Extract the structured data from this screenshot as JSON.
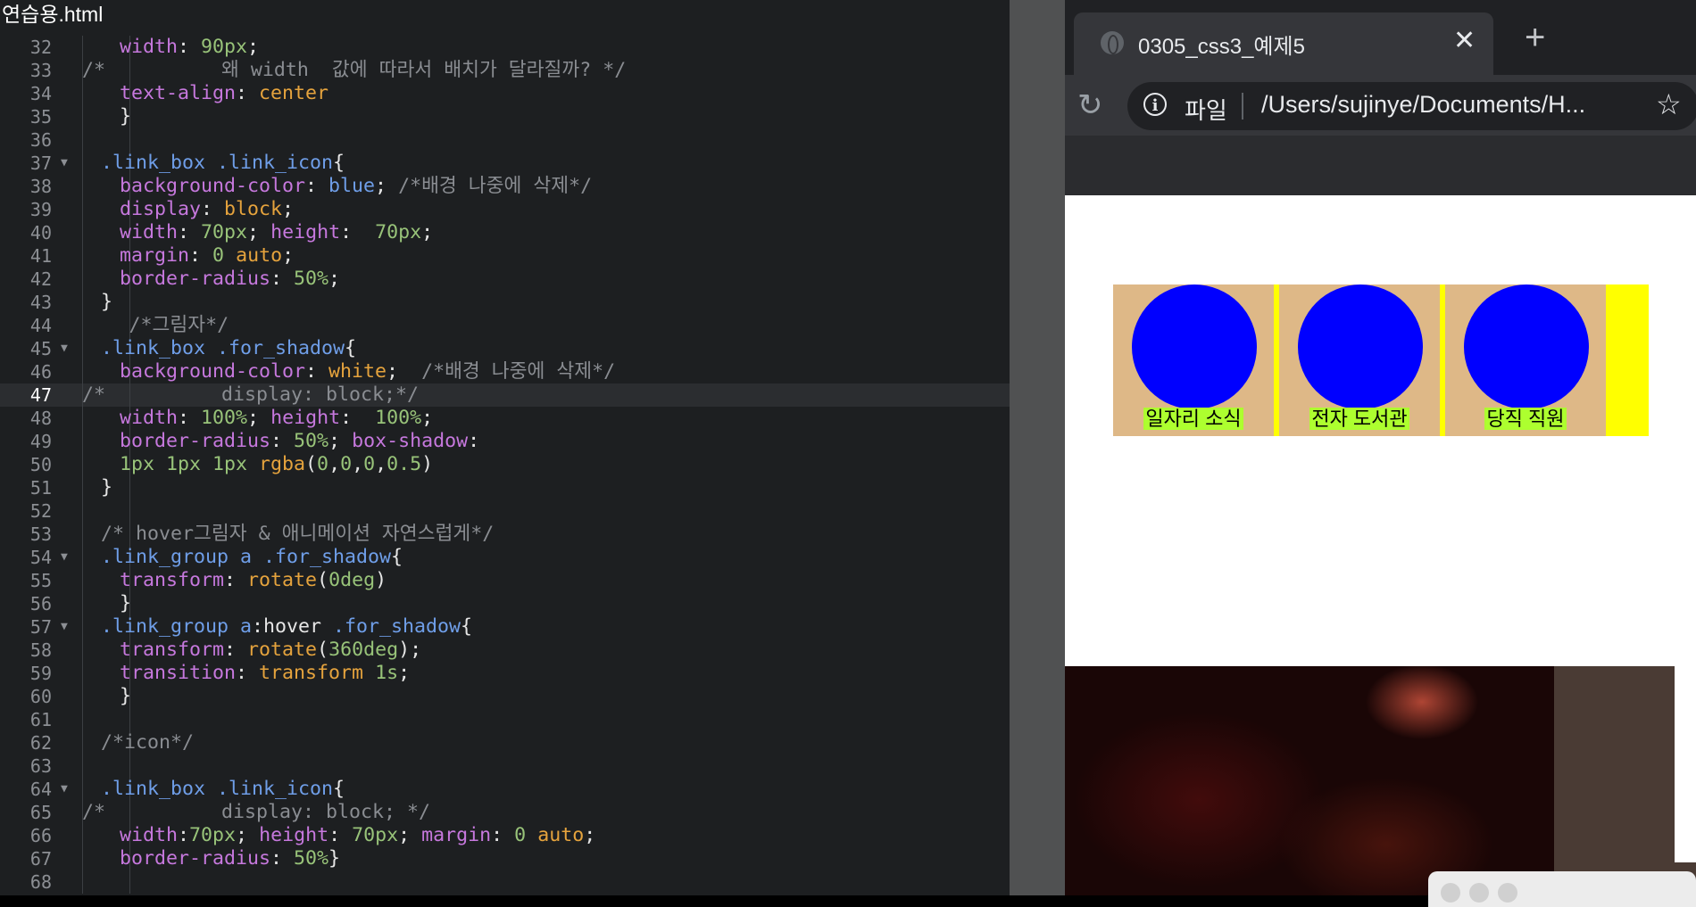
{
  "editor": {
    "file_title": "연습용.html",
    "lines": [
      {
        "n": "32",
        "tokens": [
          [
            "prop",
            "width"
          ],
          [
            "def",
            ": "
          ],
          [
            "num",
            "90px"
          ],
          [
            "def",
            ";"
          ]
        ]
      },
      {
        "n": "33",
        "tokens": [
          [
            "com",
            "/*          왜 width  값에 따라서 배치가 달라질까? */"
          ]
        ]
      },
      {
        "n": "34",
        "tokens": [
          [
            "prop",
            "text-align"
          ],
          [
            "def",
            ": "
          ],
          [
            "val",
            "center"
          ]
        ]
      },
      {
        "n": "35",
        "tokens": [
          [
            "def",
            "}"
          ]
        ]
      },
      {
        "n": "36",
        "tokens": []
      },
      {
        "n": "37",
        "fold": true,
        "tokens": [
          [
            "sel",
            ".link_box .link_icon"
          ],
          [
            "def",
            "{"
          ]
        ]
      },
      {
        "n": "38",
        "tokens": [
          [
            "prop",
            "background-color"
          ],
          [
            "def",
            ": "
          ],
          [
            "blue",
            "blue"
          ],
          [
            "def",
            "; "
          ],
          [
            "com",
            "/*배경 나중에 삭제*/"
          ]
        ]
      },
      {
        "n": "39",
        "tokens": [
          [
            "prop",
            "display"
          ],
          [
            "def",
            ": "
          ],
          [
            "val",
            "block"
          ],
          [
            "def",
            ";"
          ]
        ]
      },
      {
        "n": "40",
        "tokens": [
          [
            "prop",
            "width"
          ],
          [
            "def",
            ": "
          ],
          [
            "num",
            "70px"
          ],
          [
            "def",
            "; "
          ],
          [
            "prop",
            "height"
          ],
          [
            "def",
            ":  "
          ],
          [
            "num",
            "70px"
          ],
          [
            "def",
            ";"
          ]
        ]
      },
      {
        "n": "41",
        "tokens": [
          [
            "prop",
            "margin"
          ],
          [
            "def",
            ": "
          ],
          [
            "num",
            "0"
          ],
          [
            "def",
            " "
          ],
          [
            "val",
            "auto"
          ],
          [
            "def",
            ";"
          ]
        ]
      },
      {
        "n": "42",
        "tokens": [
          [
            "prop",
            "border-radius"
          ],
          [
            "def",
            ": "
          ],
          [
            "num",
            "50%"
          ],
          [
            "def",
            ";"
          ]
        ]
      },
      {
        "n": "43",
        "tokens": [
          [
            "def",
            "}"
          ]
        ]
      },
      {
        "n": "44",
        "tokens": [
          [
            "com",
            "/*그림자*/"
          ]
        ]
      },
      {
        "n": "45",
        "fold": true,
        "tokens": [
          [
            "sel",
            ".link_box .for_shadow"
          ],
          [
            "def",
            "{"
          ]
        ]
      },
      {
        "n": "46",
        "tokens": [
          [
            "prop",
            "background-color"
          ],
          [
            "def",
            ": "
          ],
          [
            "val",
            "white"
          ],
          [
            "def",
            ";  "
          ],
          [
            "com",
            "/*배경 나중에 삭제*/"
          ]
        ]
      },
      {
        "n": "47",
        "active": true,
        "tokens": [
          [
            "com",
            "/*          display: block;*/"
          ]
        ]
      },
      {
        "n": "48",
        "tokens": [
          [
            "prop",
            "width"
          ],
          [
            "def",
            ": "
          ],
          [
            "num",
            "100%"
          ],
          [
            "def",
            "; "
          ],
          [
            "prop",
            "height"
          ],
          [
            "def",
            ":  "
          ],
          [
            "num",
            "100%"
          ],
          [
            "def",
            ";"
          ]
        ]
      },
      {
        "n": "49",
        "tokens": [
          [
            "prop",
            "border-radius"
          ],
          [
            "def",
            ": "
          ],
          [
            "num",
            "50%"
          ],
          [
            "def",
            "; "
          ],
          [
            "prop",
            "box-shadow"
          ],
          [
            "def",
            ":"
          ]
        ]
      },
      {
        "n": "50",
        "tokens": [
          [
            "num",
            "1px 1px 1px "
          ],
          [
            "val",
            "rgba"
          ],
          [
            "def",
            "("
          ],
          [
            "num",
            "0"
          ],
          [
            "def",
            ","
          ],
          [
            "num",
            "0"
          ],
          [
            "def",
            ","
          ],
          [
            "num",
            "0"
          ],
          [
            "def",
            ","
          ],
          [
            "num",
            "0.5"
          ],
          [
            "def",
            ")"
          ]
        ]
      },
      {
        "n": "51",
        "tokens": [
          [
            "def",
            "}"
          ]
        ]
      },
      {
        "n": "52",
        "tokens": []
      },
      {
        "n": "53",
        "tokens": [
          [
            "com",
            "/* hover그림자 & 애니메이션 자연스럽게*/"
          ]
        ]
      },
      {
        "n": "54",
        "fold": true,
        "tokens": [
          [
            "sel",
            ".link_group a .for_shadow"
          ],
          [
            "def",
            "{"
          ]
        ]
      },
      {
        "n": "55",
        "tokens": [
          [
            "prop",
            "transform"
          ],
          [
            "def",
            ": "
          ],
          [
            "val",
            "rotate"
          ],
          [
            "def",
            "("
          ],
          [
            "num",
            "0deg"
          ],
          [
            "def",
            ")"
          ]
        ]
      },
      {
        "n": "56",
        "tokens": [
          [
            "def",
            "}"
          ]
        ]
      },
      {
        "n": "57",
        "fold": true,
        "tokens": [
          [
            "sel",
            ".link_group a"
          ],
          [
            "def",
            ":hover "
          ],
          [
            "sel",
            ".for_shadow"
          ],
          [
            "def",
            "{"
          ]
        ]
      },
      {
        "n": "58",
        "tokens": [
          [
            "prop",
            "transform"
          ],
          [
            "def",
            ": "
          ],
          [
            "val",
            "rotate"
          ],
          [
            "def",
            "("
          ],
          [
            "num",
            "360deg"
          ],
          [
            "def",
            ");"
          ]
        ]
      },
      {
        "n": "59",
        "tokens": [
          [
            "prop",
            "transition"
          ],
          [
            "def",
            ": "
          ],
          [
            "val",
            "transform"
          ],
          [
            "def",
            " "
          ],
          [
            "num",
            "1s"
          ],
          [
            "def",
            ";"
          ]
        ]
      },
      {
        "n": "60",
        "tokens": [
          [
            "def",
            "}"
          ]
        ]
      },
      {
        "n": "61",
        "tokens": []
      },
      {
        "n": "62",
        "tokens": [
          [
            "com",
            "/*icon*/"
          ]
        ]
      },
      {
        "n": "63",
        "tokens": []
      },
      {
        "n": "64",
        "fold": true,
        "tokens": [
          [
            "sel",
            ".link_box .link_icon"
          ],
          [
            "def",
            "{"
          ]
        ]
      },
      {
        "n": "65",
        "tokens": [
          [
            "com",
            "/*          display: block; */"
          ]
        ]
      },
      {
        "n": "66",
        "tokens": [
          [
            "prop",
            "width"
          ],
          [
            "def",
            ":"
          ],
          [
            "num",
            "70px"
          ],
          [
            "def",
            "; "
          ],
          [
            "prop",
            "height"
          ],
          [
            "def",
            ": "
          ],
          [
            "num",
            "70px"
          ],
          [
            "def",
            "; "
          ],
          [
            "prop",
            "margin"
          ],
          [
            "def",
            ": "
          ],
          [
            "num",
            "0"
          ],
          [
            "def",
            " "
          ],
          [
            "val",
            "auto"
          ],
          [
            "def",
            ";"
          ]
        ]
      },
      {
        "n": "67",
        "tokens": [
          [
            "prop",
            "border-radius"
          ],
          [
            "def",
            ": "
          ],
          [
            "num",
            "50%"
          ],
          [
            "def",
            "}"
          ]
        ]
      },
      {
        "n": "68",
        "tokens": []
      }
    ]
  },
  "browser": {
    "tab_title": "0305_css3_예제5",
    "tab_close": "✕",
    "new_tab": "+",
    "reload_icon": "↻",
    "url_scheme": "파일",
    "url_path": "/Users/sujinye/Documents/H...",
    "star_icon": "☆",
    "info_icon": "i",
    "links": [
      {
        "label": "일자리 소식"
      },
      {
        "label": "전자 도서관"
      },
      {
        "label": "당직 직원"
      }
    ],
    "colors": {
      "link_box": "#deb887",
      "link_icon": "#0000ff",
      "link_group": "#ffff00",
      "label_bg": "#adff2f"
    }
  }
}
